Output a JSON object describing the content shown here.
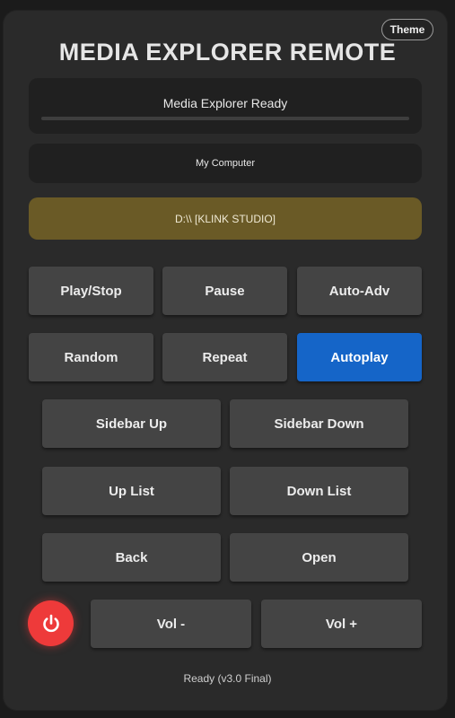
{
  "header": {
    "theme_label": "Theme",
    "title": "MEDIA EXPLORER REMOTE"
  },
  "status": {
    "text": "Media Explorer Ready",
    "progress": 0
  },
  "location": "My Computer",
  "path": "D:\\\\ [KLINK STUDIO]",
  "buttons": {
    "play_stop": "Play/Stop",
    "pause": "Pause",
    "auto_adv": "Auto-Adv",
    "random": "Random",
    "repeat": "Repeat",
    "autoplay": "Autoplay",
    "sidebar_up": "Sidebar Up",
    "sidebar_down": "Sidebar Down",
    "up_list": "Up List",
    "down_list": "Down List",
    "back": "Back",
    "open": "Open",
    "vol_down": "Vol -",
    "vol_up": "Vol +"
  },
  "power_icon": "power-icon",
  "colors": {
    "accent_active": "#1565c8",
    "path_background": "#6a5a26",
    "power": "#ee3a3a"
  },
  "footer": "Ready (v3.0 Final)"
}
